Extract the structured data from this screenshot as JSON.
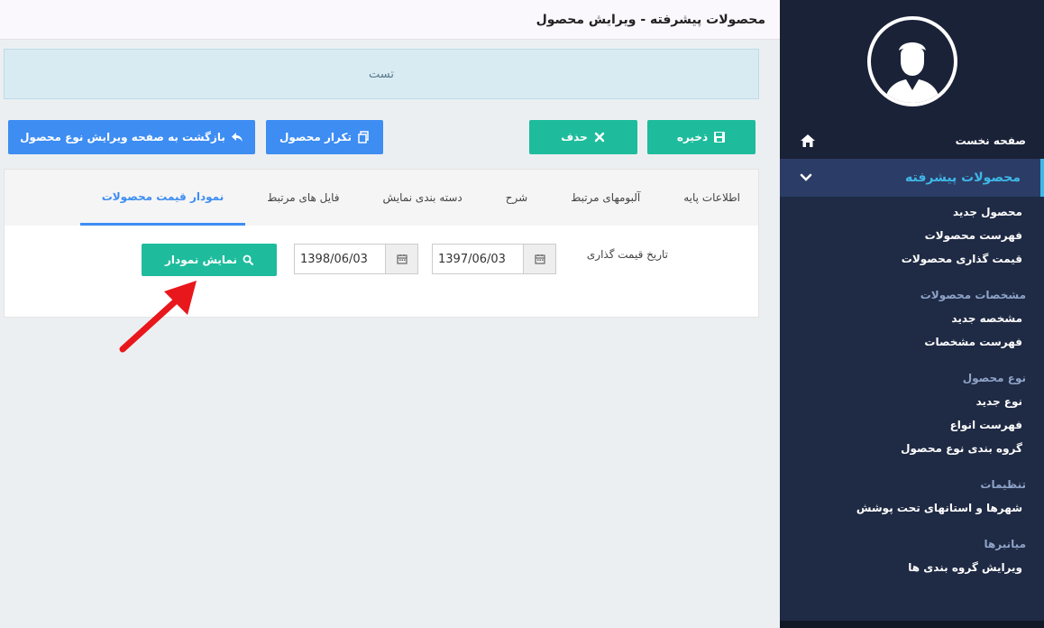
{
  "header": {
    "title": "محصولات پیشرفته - ویرایش محصول"
  },
  "alert": {
    "text": "تست"
  },
  "toolbar": {
    "save_label": "ذخیره",
    "delete_label": "حذف",
    "duplicate_label": "تکرار محصول",
    "back_label": "بازگشت به صفحه ویرایش نوع محصول"
  },
  "tabs": [
    {
      "label": "اطلاعات پایه"
    },
    {
      "label": "آلبومهای مرتبط"
    },
    {
      "label": "شرح"
    },
    {
      "label": "دسته بندی نمایش"
    },
    {
      "label": "فایل های مرتبط"
    },
    {
      "label": "نمودار قیمت محصولات"
    }
  ],
  "form": {
    "label": "تاریخ قیمت گذاری",
    "date_from": "1397/06/03",
    "date_to": "1398/06/03",
    "show_chart_label": "نمایش نمودار"
  },
  "sidebar": {
    "home": "صفحه نخست",
    "active_menu": "محصولات پیشرفته",
    "active_items": [
      "محصول جدید",
      "فهرست محصولات",
      "قیمت گذاری محصولات"
    ],
    "sections": [
      {
        "title": "مشخصات محصولات",
        "items": [
          "مشخصه جدید",
          "فهرست مشخصات"
        ]
      },
      {
        "title": "نوع محصول",
        "items": [
          "نوع جدید",
          "فهرست انواع",
          "گروه بندی نوع محصول"
        ]
      },
      {
        "title": "تنظیمات",
        "items": [
          "شهرها و استانهای تحت پوشش"
        ]
      },
      {
        "title": "میانبرها",
        "items": [
          "ویرایش گروه بندی ها"
        ]
      }
    ]
  },
  "colors": {
    "accent": "#1ebc9c",
    "primary": "#3d8df3",
    "sidebar": "#1f2a44",
    "highlight": "#3fb7e8"
  }
}
